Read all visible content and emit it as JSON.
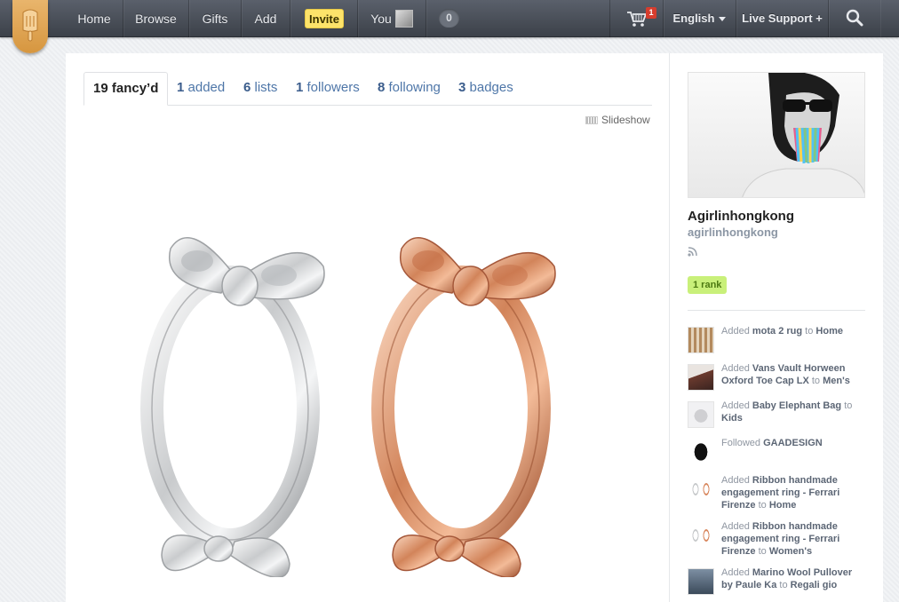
{
  "nav": {
    "home": "Home",
    "browse": "Browse",
    "gifts": "Gifts",
    "add": "Add",
    "invite": "Invite",
    "you": "You",
    "notification_count": "0",
    "cart_count": "1",
    "language": "English",
    "support": "Live Support +"
  },
  "tabs": [
    {
      "count": "19",
      "label": "fancy’d"
    },
    {
      "count": "1",
      "label": "added"
    },
    {
      "count": "6",
      "label": "lists"
    },
    {
      "count": "1",
      "label": "followers"
    },
    {
      "count": "8",
      "label": "following"
    },
    {
      "count": "3",
      "label": "badges"
    }
  ],
  "slideshow_label": "Slideshow",
  "profile": {
    "name": "Agirlinhongkong",
    "handle": "agirlinhongkong",
    "rank": "1 rank"
  },
  "activity": [
    {
      "verb": "Added",
      "item": "mota 2 rug",
      "prep": "to",
      "target": "Home"
    },
    {
      "verb": "Added",
      "item": "Vans Vault Horween Oxford Toe Cap LX",
      "prep": "to",
      "target": "Men's"
    },
    {
      "verb": "Added",
      "item": "Baby Elephant Bag",
      "prep": "to",
      "target": "Kids"
    },
    {
      "verb": "Followed",
      "item": "GAADESIGN",
      "prep": "",
      "target": ""
    },
    {
      "verb": "Added",
      "item": "Ribbon handmade engagement ring - Ferrari Firenze",
      "prep": "to",
      "target": "Home"
    },
    {
      "verb": "Added",
      "item": "Ribbon handmade engagement ring - Ferrari Firenze",
      "prep": "to",
      "target": "Women's"
    },
    {
      "verb": "Added",
      "item": "Marino Wool Pullover by Paule Ka",
      "prep": "to",
      "target": "Regali gio"
    }
  ],
  "colors": {
    "nav_bg": "#464b54",
    "link": "#4e76a8",
    "invite_bg": "#fde36a",
    "rank_bg": "#c9f07a",
    "cart_badge": "#d63d2e",
    "silver_ring": "#d9dbdd",
    "rose_ring": "#d98a62"
  }
}
